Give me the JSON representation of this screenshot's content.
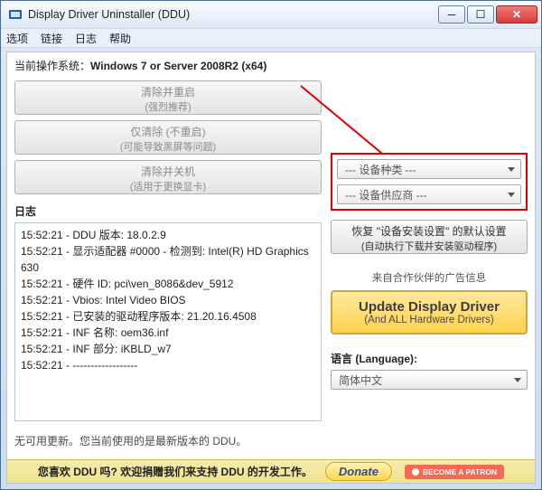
{
  "window": {
    "title": "Display Driver Uninstaller (DDU)"
  },
  "menu": {
    "options": "选项",
    "links": "链接",
    "logs": "日志",
    "help": "帮助"
  },
  "os": {
    "label": "当前操作系统：",
    "value": "Windows 7 or Server 2008R2 (x64)"
  },
  "actions": {
    "clean_restart_l1": "清除并重启",
    "clean_restart_l2": "(强烈推荐)",
    "clean_only_l1": "仅清除 (不重启)",
    "clean_only_l2": "(可能导致黑屏等问题)",
    "clean_shutdown_l1": "清除并关机",
    "clean_shutdown_l2": "(适用于更换显卡)"
  },
  "log": {
    "header": "日志",
    "lines": [
      "15:52:21 - DDU 版本: 18.0.2.9",
      "15:52:21 - 显示适配器 #0000 - 检测到: Intel(R) HD Graphics 630",
      "15:52:21 - 硬件 ID: pci\\ven_8086&dev_5912",
      "15:52:21 - Vbios: Intel Video BIOS",
      "15:52:21 - 已安装的驱动程序版本: 21.20.16.4508",
      "15:52:21 - INF 名称: oem36.inf",
      "15:52:21 - INF 部分: iKBLD_w7",
      "15:52:21 - ------------------"
    ]
  },
  "update_status": "无可用更新。您当前使用的是最新版本的 DDU。",
  "selectors": {
    "device_type": "--- 设备种类 ---",
    "device_vendor": "--- 设备供应商 ---"
  },
  "restore": {
    "l1": "恢复 \"设备安装设置\" 的默认设置",
    "l2": "(自动执行下载并安装驱动程序)"
  },
  "ad": {
    "header": "来自合作伙伴的广告信息",
    "l1": "Update Display Driver",
    "l2": "(And ALL Hardware Drivers)"
  },
  "lang": {
    "label": "语言 (Language):",
    "value": "简体中文"
  },
  "footer": {
    "text": "您喜欢 DDU 吗? 欢迎捐赠我们来支持 DDU 的开发工作。",
    "donate": "Donate",
    "patron": "BECOME A PATRON"
  }
}
